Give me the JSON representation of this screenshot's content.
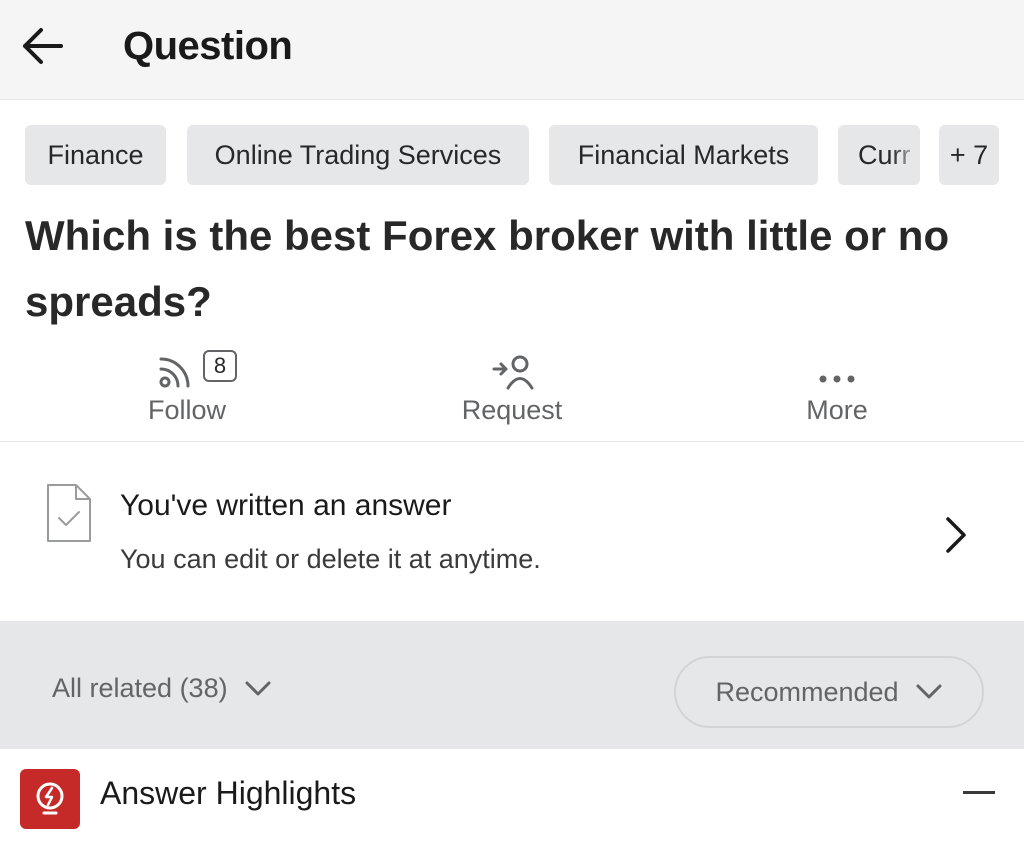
{
  "header": {
    "title": "Question",
    "back_icon": "arrow-left-icon"
  },
  "topics": [
    {
      "label": "Finance"
    },
    {
      "label": "Online Trading Services"
    },
    {
      "label": "Financial Markets"
    },
    {
      "label": "Curr"
    },
    {
      "label": "+ 7"
    }
  ],
  "question": {
    "text": "Which is the best Forex broker with little or no spreads?"
  },
  "actions": {
    "follow": {
      "label": "Follow",
      "count": "8",
      "icon": "follow-feed-icon"
    },
    "request": {
      "label": "Request",
      "icon": "request-user-icon"
    },
    "more": {
      "label": "More",
      "icon": "more-dots-icon"
    }
  },
  "written_answer": {
    "title": "You've written an answer",
    "subtitle": "You can edit or delete it at anytime."
  },
  "related": {
    "all_related_label": "All related (38)",
    "sort_label": "Recommended"
  },
  "highlights": {
    "title": "Answer Highlights",
    "icon_color": "#c52a29"
  },
  "colors": {
    "header_bg": "#f5f5f5",
    "chip_bg": "#e6e7e8",
    "muted_text": "#636466",
    "accent_red": "#c52a29"
  }
}
